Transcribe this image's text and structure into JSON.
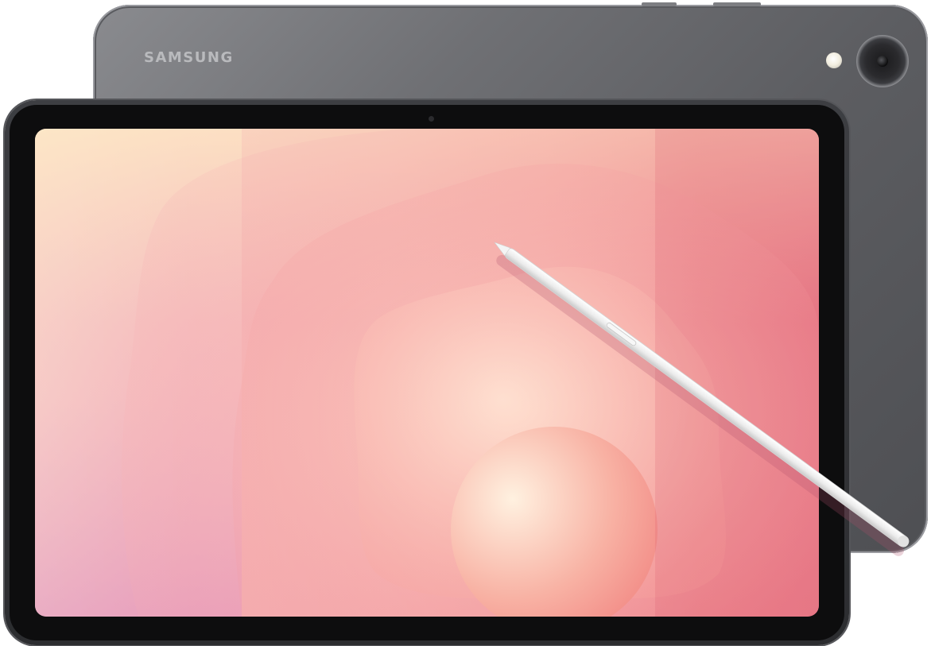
{
  "device": {
    "brand": "SAMSUNG"
  },
  "colors": {
    "body": "#6f7074",
    "bezel": "#0d0d0e",
    "screen_warm": "#f9d7c8",
    "screen_pink": "#ef8d95",
    "screen_coral": "#e8707c",
    "stylus": "#eeeeee"
  }
}
